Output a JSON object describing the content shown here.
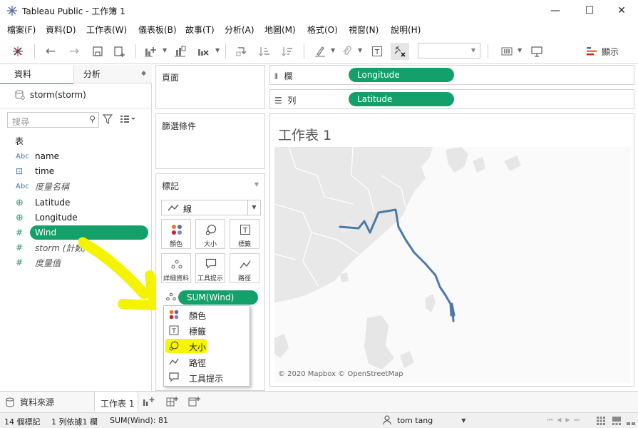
{
  "window": {
    "title": "Tableau Public - 工作簿 1",
    "minimize": "—",
    "maximize": "☐",
    "close": "✕"
  },
  "menu": [
    "檔案(F)",
    "資料(D)",
    "工作表(W)",
    "儀表板(B)",
    "故事(T)",
    "分析(A)",
    "地圖(M)",
    "格式(O)",
    "視窗(N)",
    "說明(H)"
  ],
  "toolbar": {
    "show_me": "顯示"
  },
  "datapane": {
    "tab_data": "資料",
    "tab_analysis": "分析",
    "datasource": "storm(storm)",
    "search_placeholder": "搜尋",
    "section": "表",
    "fields": [
      {
        "icon": "Abc",
        "name": "name",
        "italic": false
      },
      {
        "icon": "⊡",
        "name": "time",
        "italic": false
      },
      {
        "icon": "Abc",
        "name": "度量名稱",
        "italic": true
      },
      {
        "icon": "⊕",
        "name": "Latitude",
        "italic": false
      },
      {
        "icon": "⊕",
        "name": "Longitude",
        "italic": false
      },
      {
        "icon": "#",
        "name": "Wind",
        "italic": false
      },
      {
        "icon": "#",
        "name": "storm (計數)",
        "italic": true
      },
      {
        "icon": "#",
        "name": "度量值",
        "italic": true
      }
    ]
  },
  "pages_card": {
    "label": "頁面"
  },
  "filters_card": {
    "label": "篩選條件"
  },
  "marks_card": {
    "label": "標記",
    "mark_type": "線",
    "buttons": [
      {
        "icon": "●",
        "label": "顏色"
      },
      {
        "icon": "◯",
        "label": "大小"
      },
      {
        "icon": "T",
        "label": "標籤"
      },
      {
        "icon": "∴",
        "label": "詳細資料"
      },
      {
        "icon": "▭",
        "label": "工具提示"
      },
      {
        "icon": "〜",
        "label": "路徑"
      }
    ],
    "pill": "SUM(Wind)"
  },
  "context_menu": {
    "items": [
      {
        "icon": "●",
        "label": "顏色"
      },
      {
        "icon": "T",
        "label": "標籤"
      },
      {
        "icon": "◯",
        "label": "大小"
      },
      {
        "icon": "〜",
        "label": "路徑"
      },
      {
        "icon": "▭",
        "label": "工具提示"
      }
    ]
  },
  "shelves": {
    "columns_label": "欄",
    "columns_pill": "Longitude",
    "rows_label": "列",
    "rows_pill": "Latitude"
  },
  "viz": {
    "sheet_title": "工作表 1",
    "attribution": "© 2020 Mapbox © OpenStreetMap"
  },
  "bottom": {
    "datasource_tab": "資料來源",
    "sheet_tab": "工作表 1"
  },
  "status": {
    "marks": "14 個標記",
    "rows_cols": "1 列依據1 欄",
    "sum": "SUM(Wind): 81",
    "user": "tom tang"
  }
}
